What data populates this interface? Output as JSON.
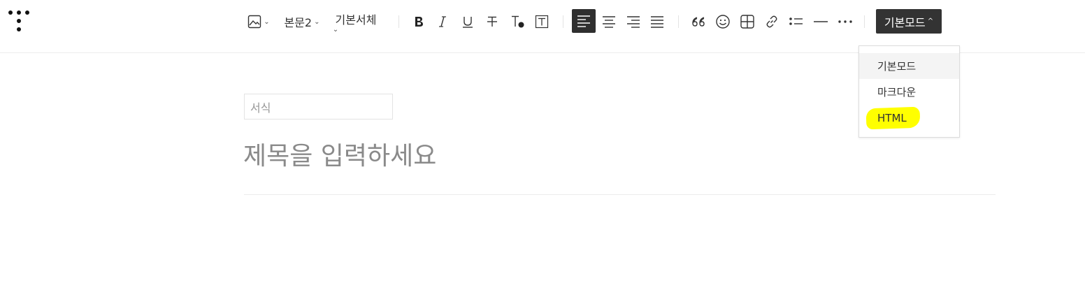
{
  "toolbar": {
    "paragraph_style": "본문2",
    "font_family": "기본서체",
    "mode_button": "기본모드"
  },
  "dropdown": {
    "items": [
      "기본모드",
      "마크다운",
      "HTML"
    ],
    "selected": "기본모드",
    "highlighted": "HTML"
  },
  "editor": {
    "category_placeholder": "서식",
    "title_placeholder": "제목을 입력하세요"
  },
  "colors": {
    "active_button": "#333333",
    "highlight": "#ffff00"
  }
}
